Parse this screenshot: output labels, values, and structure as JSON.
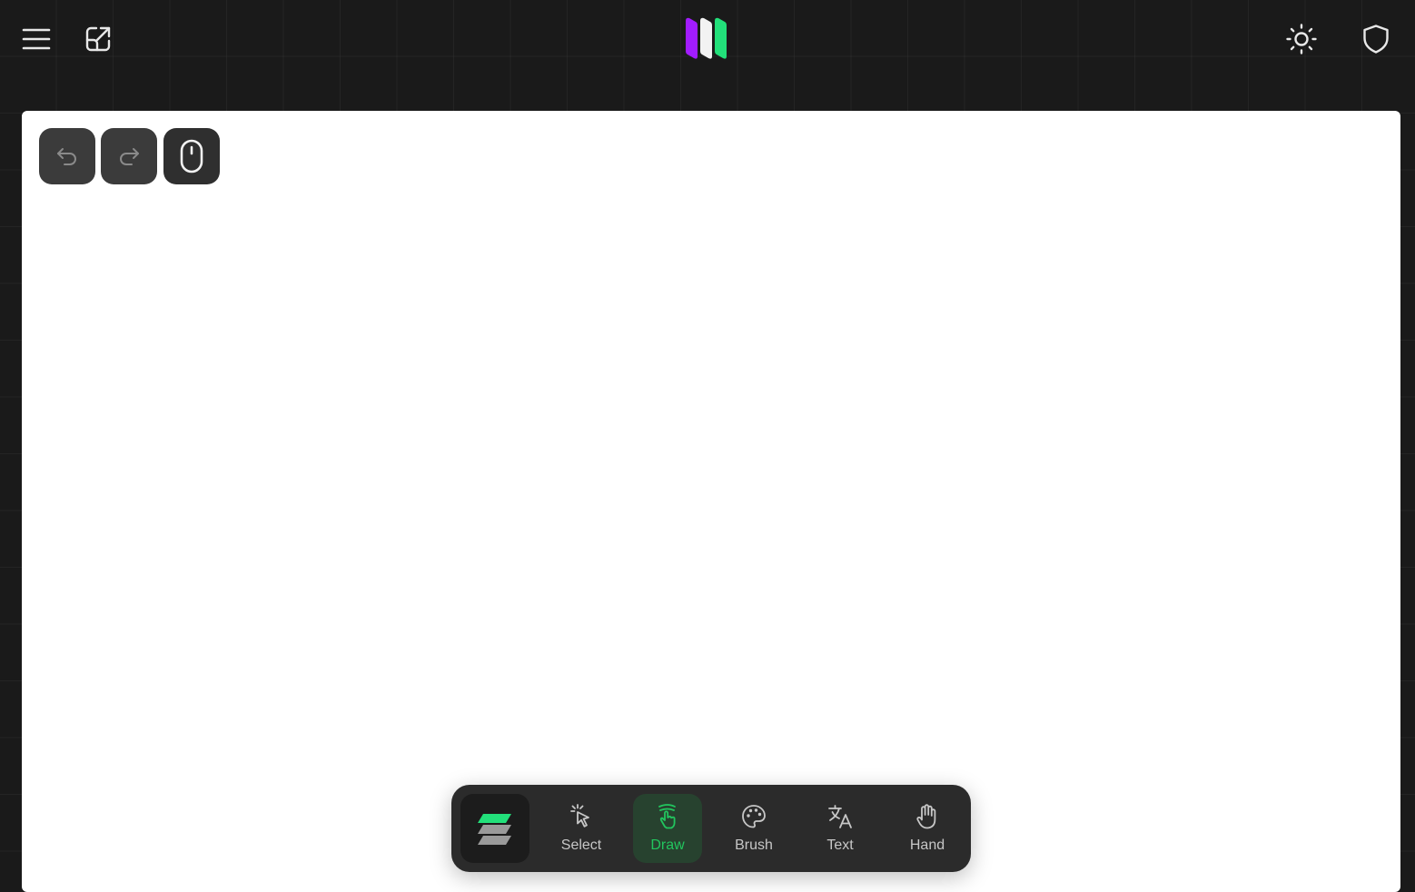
{
  "app": {
    "colors": {
      "background": "#1a1a1a",
      "canvas": "#ffffff",
      "toolbar": "#2b2b2b",
      "accent": "#22c55e",
      "logo_purple": "#a21cff",
      "logo_green": "#22e07a"
    }
  },
  "header": {
    "menu_icon": "hamburger-menu-icon",
    "export_icon": "external-link-icon",
    "logo_icon": "app-logo",
    "theme_icon": "sun-icon",
    "privacy_icon": "shield-icon"
  },
  "history": {
    "undo_icon": "undo-icon",
    "redo_icon": "redo-icon",
    "mouse_icon": "mouse-icon"
  },
  "toolbar": {
    "active_tool": "Draw",
    "tools": [
      {
        "id": "layers",
        "icon": "layers-icon",
        "label": ""
      },
      {
        "id": "select",
        "icon": "pointer-click-icon",
        "label": "Select"
      },
      {
        "id": "draw",
        "icon": "finger-draw-icon",
        "label": "Draw"
      },
      {
        "id": "brush",
        "icon": "palette-icon",
        "label": "Brush"
      },
      {
        "id": "text",
        "icon": "translate-icon",
        "label": "Text"
      },
      {
        "id": "hand",
        "icon": "hand-icon",
        "label": "Hand"
      }
    ]
  }
}
